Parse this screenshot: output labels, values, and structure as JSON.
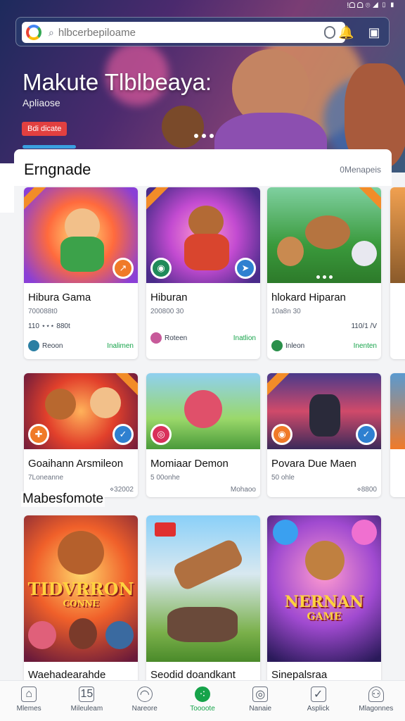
{
  "status_bar": {
    "text": "!ᗝ ᗝ ⌾ ◢ ▯ ▮"
  },
  "search": {
    "placeholder": "hlbcerbepiloame"
  },
  "hero": {
    "title": "Makute Tlblbeaya:",
    "subtitle": "Apliaose",
    "badge": "Bdi dicate",
    "carousel_dots": 3
  },
  "section": {
    "title": "Erngnade",
    "more_label": "0Menapeis"
  },
  "row1": [
    {
      "title": "Hibura Gama",
      "meta": "700088t0",
      "meta2": "110 ⋆⋆⋆ 880t",
      "dev": "Reoon",
      "install": "Inalimen"
    },
    {
      "title": "Hiburan",
      "meta": "200800 30",
      "meta2": "",
      "dev": "Roteen",
      "install": "Inatlion"
    },
    {
      "title": "hlokard Hiparan",
      "meta": "10a8n 30",
      "meta2": "110/1 /V",
      "dev": "Inleon",
      "install": "Inenten"
    }
  ],
  "row2": [
    {
      "title": "Goaihann Arsmileon",
      "meta": "7Loneanne",
      "meta2": "",
      "foot": "⋄32002",
      "dev": "",
      "install": ""
    },
    {
      "title": "Momiaar Demon",
      "meta": "5 00onhe",
      "meta2": "",
      "foot": "Mohaoo",
      "dev": "",
      "install": ""
    },
    {
      "title": "Povara Due Maen",
      "meta": "50 ohle",
      "meta2": "",
      "foot": "⋄8800",
      "dev": "",
      "install": ""
    }
  ],
  "overlay_label": "Mabesfomote",
  "row3": [
    {
      "title": "Waehadearahde",
      "art_text": "TIDVRRON",
      "art_sub": "CONNE"
    },
    {
      "title": "Seodid doandkant",
      "art_text": "",
      "art_sub": ""
    },
    {
      "title": "Sinepalsraa",
      "art_text": "NERNAN",
      "art_sub": "GAME"
    }
  ],
  "bottom_nav": [
    {
      "label": "Mlemes",
      "icon": "home-icon",
      "active": false
    },
    {
      "label": "Mileuleam",
      "icon": "calendar-icon",
      "active": false
    },
    {
      "label": "Nareore",
      "icon": "chat-icon",
      "active": false
    },
    {
      "label": "Toooote",
      "icon": "games-icon",
      "active": true
    },
    {
      "label": "Nanaie",
      "icon": "image-icon",
      "active": false
    },
    {
      "label": "Asplick",
      "icon": "message-icon",
      "active": false
    },
    {
      "label": "Mlagonnes",
      "icon": "profile-icon",
      "active": false
    }
  ],
  "colors": {
    "accent_green": "#16a34a",
    "badge_red": "#e24040",
    "tab_blue": "#3aa0e0"
  }
}
